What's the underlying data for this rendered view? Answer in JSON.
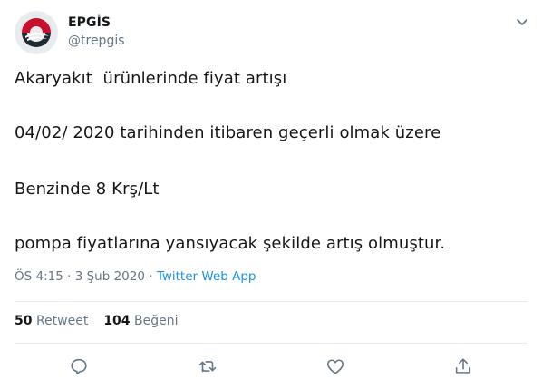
{
  "user": {
    "name": "EPGİS",
    "handle": "@trepgis",
    "avatar_icon": "epgis-logo-icon"
  },
  "tweet": {
    "lines": [
      "Akaryakıt  ürünlerinde fiyat artışı",
      "04/02/ 2020 tarihinden itibaren geçerli olmak üzere",
      "Benzinde 8 Krş/Lt",
      "pompa fiyatlarına yansıyacak şekilde artış olmuştur."
    ],
    "time": "ÖS 4:15",
    "separator": "·",
    "date": "3 Şub 2020",
    "source": "Twitter Web App"
  },
  "stats": {
    "retweets_count": "50",
    "retweets_label": "Retweet",
    "likes_count": "104",
    "likes_label": "Beğeni"
  },
  "actions": [
    {
      "icon": "reply-icon"
    },
    {
      "icon": "retweet-icon"
    },
    {
      "icon": "like-icon"
    },
    {
      "icon": "share-icon"
    }
  ],
  "colors": {
    "text": "#14171a",
    "secondary": "#657786",
    "link": "#1b95e0",
    "divider": "#e6ecf0",
    "logo_red": "#c8102e",
    "logo_dark": "#1f2a33"
  }
}
